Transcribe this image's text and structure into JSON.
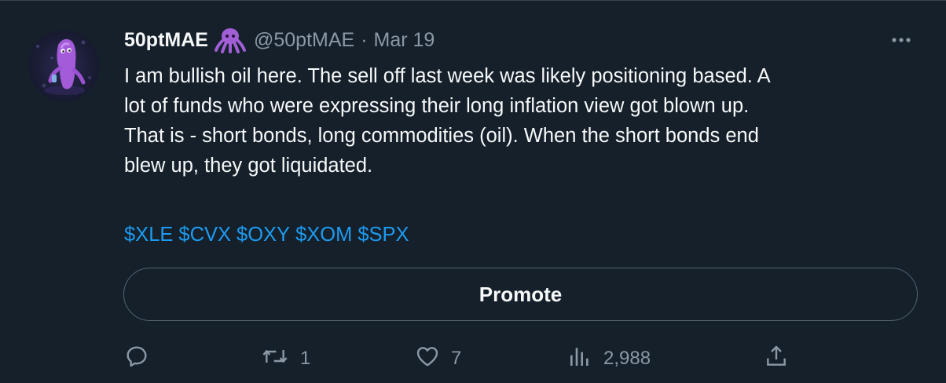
{
  "tweet": {
    "display_name": "50ptMAE",
    "handle": "@50ptMAE",
    "separator": "·",
    "date": "Mar 19",
    "text": "I am bullish oil here. The sell off last week was likely positioning based. A\nlot of funds who were expressing their long inflation view got blown up.\nThat is - short bonds, long commodities (oil). When the short bonds end\nblew up, they got liquidated.",
    "tickers": [
      "$XLE",
      "$CVX",
      "$OXY",
      "$XOM",
      "$SPX"
    ],
    "promote_label": "Promote",
    "metrics": {
      "replies": "",
      "retweets": "1",
      "likes": "7",
      "views": "2,988"
    }
  },
  "colors": {
    "background": "#15202b",
    "text": "#f7f9f9",
    "secondary": "#8b98a5",
    "link": "#1d9bf0",
    "border": "#536471",
    "emoji_purple": "#a15fd6"
  },
  "icons": {
    "emoji": "octopus-icon",
    "more": "more-icon",
    "reply": "reply-icon",
    "retweet": "retweet-icon",
    "like": "heart-icon",
    "views": "views-icon",
    "share": "share-icon"
  }
}
